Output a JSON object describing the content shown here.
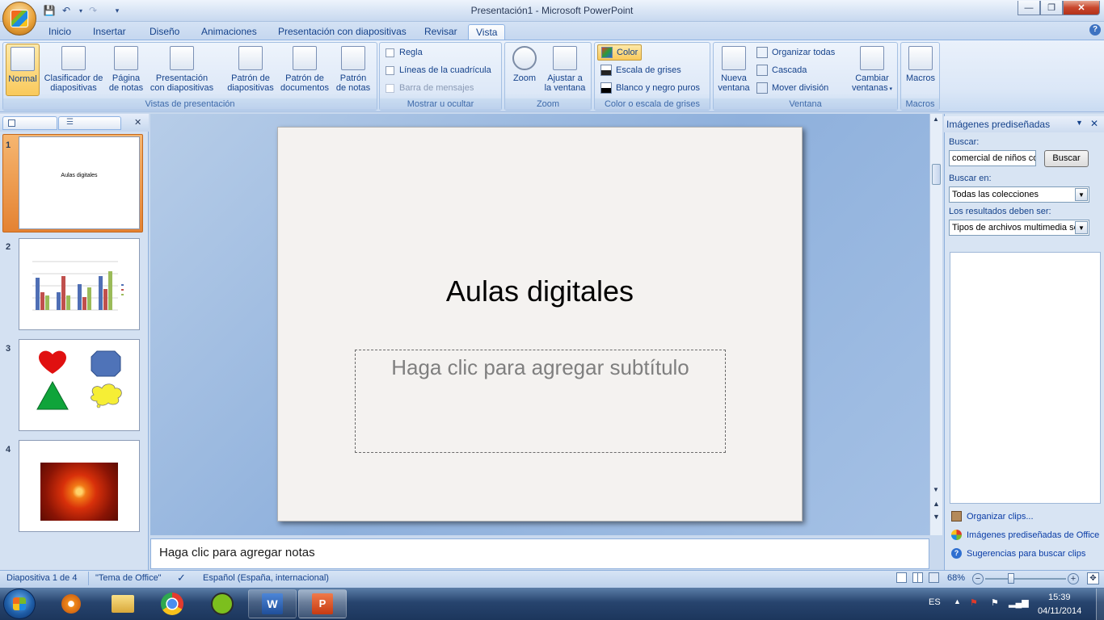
{
  "window": {
    "title": "Presentación1 - Microsoft PowerPoint"
  },
  "tabs": [
    {
      "label": "Inicio"
    },
    {
      "label": "Insertar"
    },
    {
      "label": "Diseño"
    },
    {
      "label": "Animaciones"
    },
    {
      "label": "Presentación con diapositivas"
    },
    {
      "label": "Revisar"
    },
    {
      "label": "Vista",
      "active": true
    }
  ],
  "ribbon": {
    "vistas": {
      "group_label": "Vistas de presentación",
      "normal": "Normal",
      "clasificador_1": "Clasificador de",
      "clasificador_2": "diapositivas",
      "pagina_1": "Página",
      "pagina_2": "de notas",
      "presentacion_1": "Presentación",
      "presentacion_2": "con diapositivas",
      "patron_diap_1": "Patrón de",
      "patron_diap_2": "diapositivas",
      "patron_doc_1": "Patrón de",
      "patron_doc_2": "documentos",
      "patron_notas_1": "Patrón",
      "patron_notas_2": "de notas"
    },
    "mostrar": {
      "group_label": "Mostrar u ocultar",
      "regla": "Regla",
      "lineas": "Líneas de la cuadrícula",
      "barra": "Barra de mensajes"
    },
    "zoom": {
      "group_label": "Zoom",
      "zoom": "Zoom",
      "ajustar_1": "Ajustar a",
      "ajustar_2": "la ventana"
    },
    "color": {
      "group_label": "Color o escala de grises",
      "color": "Color",
      "grises": "Escala de grises",
      "bn": "Blanco y negro puros"
    },
    "ventana": {
      "group_label": "Ventana",
      "nueva_1": "Nueva",
      "nueva_2": "ventana",
      "organizar": "Organizar todas",
      "cascada": "Cascada",
      "mover": "Mover división",
      "cambiar_1": "Cambiar",
      "cambiar_2": "ventanas"
    },
    "macros": {
      "group_label": "Macros",
      "macros": "Macros"
    }
  },
  "slides_panel": {
    "slides": [
      {
        "num": "1",
        "text": "Aulas digitales"
      },
      {
        "num": "2"
      },
      {
        "num": "3"
      },
      {
        "num": "4"
      }
    ]
  },
  "slide": {
    "title": "Aulas digitales",
    "subtitle_placeholder": "Haga clic para agregar subtítulo"
  },
  "notes": {
    "placeholder": "Haga clic para agregar notas"
  },
  "taskpane": {
    "title": "Imágenes prediseñadas",
    "buscar_label": "Buscar:",
    "buscar_value": "comercial de niños co",
    "buscar_button": "Buscar",
    "buscar_en_label": "Buscar en:",
    "buscar_en_value": "Todas las colecciones",
    "resultados_label": "Los resultados deben ser:",
    "resultados_value": "Tipos de archivos multimedia se",
    "link_organizar": "Organizar clips...",
    "link_office": "Imágenes prediseñadas de Office",
    "link_sugerencias": "Sugerencias para buscar clips"
  },
  "statusbar": {
    "slide_info": "Diapositiva 1 de 4",
    "theme": "\"Tema de Office\"",
    "language": "Español (España, internacional)",
    "zoom": "68%"
  },
  "taskbar": {
    "lang": "ES",
    "time": "15:39",
    "date": "04/11/2014"
  },
  "colors": {
    "accent": "#15428b",
    "selected_slide": "#e9862e",
    "close": "#c8462c"
  }
}
